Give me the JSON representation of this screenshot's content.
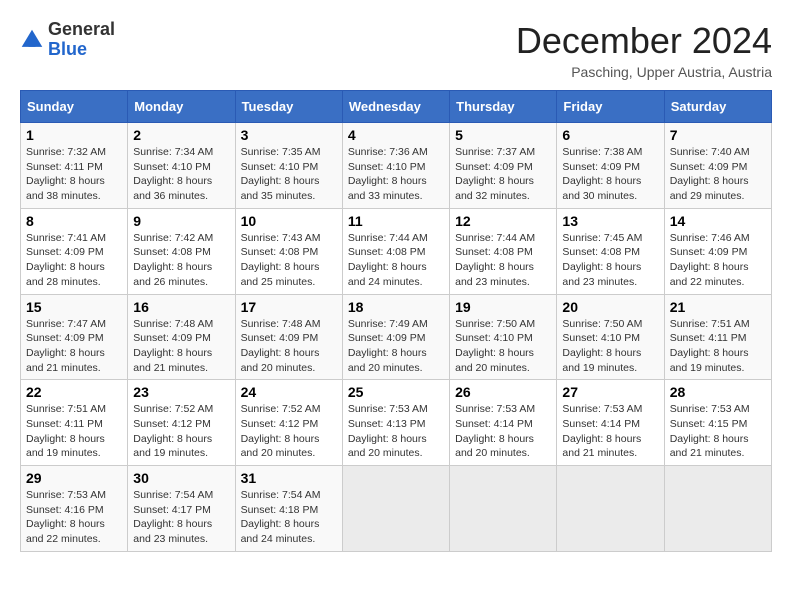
{
  "header": {
    "logo_general": "General",
    "logo_blue": "Blue",
    "month_title": "December 2024",
    "location": "Pasching, Upper Austria, Austria"
  },
  "weekdays": [
    "Sunday",
    "Monday",
    "Tuesday",
    "Wednesday",
    "Thursday",
    "Friday",
    "Saturday"
  ],
  "weeks": [
    [
      {
        "day": 1,
        "sunrise": "7:32 AM",
        "sunset": "4:11 PM",
        "daylight": "8 hours and 38 minutes"
      },
      {
        "day": 2,
        "sunrise": "7:34 AM",
        "sunset": "4:10 PM",
        "daylight": "8 hours and 36 minutes"
      },
      {
        "day": 3,
        "sunrise": "7:35 AM",
        "sunset": "4:10 PM",
        "daylight": "8 hours and 35 minutes"
      },
      {
        "day": 4,
        "sunrise": "7:36 AM",
        "sunset": "4:10 PM",
        "daylight": "8 hours and 33 minutes"
      },
      {
        "day": 5,
        "sunrise": "7:37 AM",
        "sunset": "4:09 PM",
        "daylight": "8 hours and 32 minutes"
      },
      {
        "day": 6,
        "sunrise": "7:38 AM",
        "sunset": "4:09 PM",
        "daylight": "8 hours and 30 minutes"
      },
      {
        "day": 7,
        "sunrise": "7:40 AM",
        "sunset": "4:09 PM",
        "daylight": "8 hours and 29 minutes"
      }
    ],
    [
      {
        "day": 8,
        "sunrise": "7:41 AM",
        "sunset": "4:09 PM",
        "daylight": "8 hours and 28 minutes"
      },
      {
        "day": 9,
        "sunrise": "7:42 AM",
        "sunset": "4:08 PM",
        "daylight": "8 hours and 26 minutes"
      },
      {
        "day": 10,
        "sunrise": "7:43 AM",
        "sunset": "4:08 PM",
        "daylight": "8 hours and 25 minutes"
      },
      {
        "day": 11,
        "sunrise": "7:44 AM",
        "sunset": "4:08 PM",
        "daylight": "8 hours and 24 minutes"
      },
      {
        "day": 12,
        "sunrise": "7:44 AM",
        "sunset": "4:08 PM",
        "daylight": "8 hours and 23 minutes"
      },
      {
        "day": 13,
        "sunrise": "7:45 AM",
        "sunset": "4:08 PM",
        "daylight": "8 hours and 23 minutes"
      },
      {
        "day": 14,
        "sunrise": "7:46 AM",
        "sunset": "4:09 PM",
        "daylight": "8 hours and 22 minutes"
      }
    ],
    [
      {
        "day": 15,
        "sunrise": "7:47 AM",
        "sunset": "4:09 PM",
        "daylight": "8 hours and 21 minutes"
      },
      {
        "day": 16,
        "sunrise": "7:48 AM",
        "sunset": "4:09 PM",
        "daylight": "8 hours and 21 minutes"
      },
      {
        "day": 17,
        "sunrise": "7:48 AM",
        "sunset": "4:09 PM",
        "daylight": "8 hours and 20 minutes"
      },
      {
        "day": 18,
        "sunrise": "7:49 AM",
        "sunset": "4:09 PM",
        "daylight": "8 hours and 20 minutes"
      },
      {
        "day": 19,
        "sunrise": "7:50 AM",
        "sunset": "4:10 PM",
        "daylight": "8 hours and 20 minutes"
      },
      {
        "day": 20,
        "sunrise": "7:50 AM",
        "sunset": "4:10 PM",
        "daylight": "8 hours and 19 minutes"
      },
      {
        "day": 21,
        "sunrise": "7:51 AM",
        "sunset": "4:11 PM",
        "daylight": "8 hours and 19 minutes"
      }
    ],
    [
      {
        "day": 22,
        "sunrise": "7:51 AM",
        "sunset": "4:11 PM",
        "daylight": "8 hours and 19 minutes"
      },
      {
        "day": 23,
        "sunrise": "7:52 AM",
        "sunset": "4:12 PM",
        "daylight": "8 hours and 19 minutes"
      },
      {
        "day": 24,
        "sunrise": "7:52 AM",
        "sunset": "4:12 PM",
        "daylight": "8 hours and 20 minutes"
      },
      {
        "day": 25,
        "sunrise": "7:53 AM",
        "sunset": "4:13 PM",
        "daylight": "8 hours and 20 minutes"
      },
      {
        "day": 26,
        "sunrise": "7:53 AM",
        "sunset": "4:14 PM",
        "daylight": "8 hours and 20 minutes"
      },
      {
        "day": 27,
        "sunrise": "7:53 AM",
        "sunset": "4:14 PM",
        "daylight": "8 hours and 21 minutes"
      },
      {
        "day": 28,
        "sunrise": "7:53 AM",
        "sunset": "4:15 PM",
        "daylight": "8 hours and 21 minutes"
      }
    ],
    [
      {
        "day": 29,
        "sunrise": "7:53 AM",
        "sunset": "4:16 PM",
        "daylight": "8 hours and 22 minutes"
      },
      {
        "day": 30,
        "sunrise": "7:54 AM",
        "sunset": "4:17 PM",
        "daylight": "8 hours and 23 minutes"
      },
      {
        "day": 31,
        "sunrise": "7:54 AM",
        "sunset": "4:18 PM",
        "daylight": "8 hours and 24 minutes"
      },
      null,
      null,
      null,
      null
    ]
  ]
}
